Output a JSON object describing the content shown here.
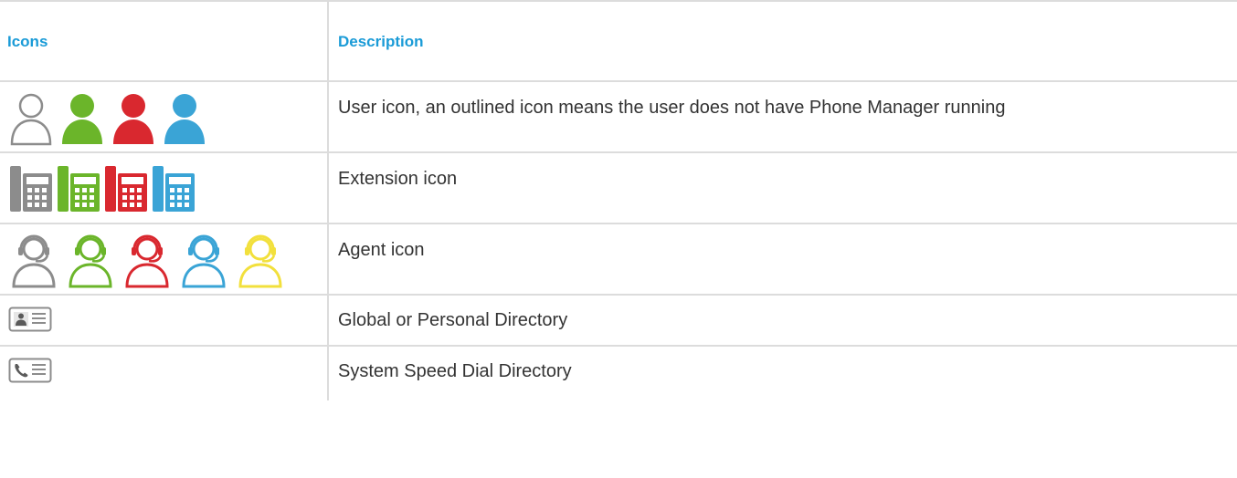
{
  "table": {
    "headers": {
      "icons": "Icons",
      "description": "Description"
    },
    "rows": [
      {
        "icons": [
          "user-icon-outline",
          "user-icon-green",
          "user-icon-red",
          "user-icon-blue"
        ],
        "description": "User icon, an outlined icon means the user does not have Phone Manager running"
      },
      {
        "icons": [
          "extension-icon-grey",
          "extension-icon-green",
          "extension-icon-red",
          "extension-icon-blue"
        ],
        "description": "Extension icon"
      },
      {
        "icons": [
          "agent-icon-grey",
          "agent-icon-green",
          "agent-icon-red",
          "agent-icon-blue",
          "agent-icon-yellow"
        ],
        "description": "Agent icon"
      },
      {
        "icons": [
          "directory-card-icon"
        ],
        "description": "Global or Personal Directory"
      },
      {
        "icons": [
          "speed-dial-card-icon"
        ],
        "description": "System Speed Dial Directory"
      }
    ]
  },
  "colors": {
    "header_text": "#1a9bd7",
    "grey": "#8c8c8c",
    "green": "#6bb52a",
    "red": "#d9282f",
    "blue": "#3aa4d6",
    "yellow": "#f2e03c",
    "border": "#dcdcdc"
  }
}
